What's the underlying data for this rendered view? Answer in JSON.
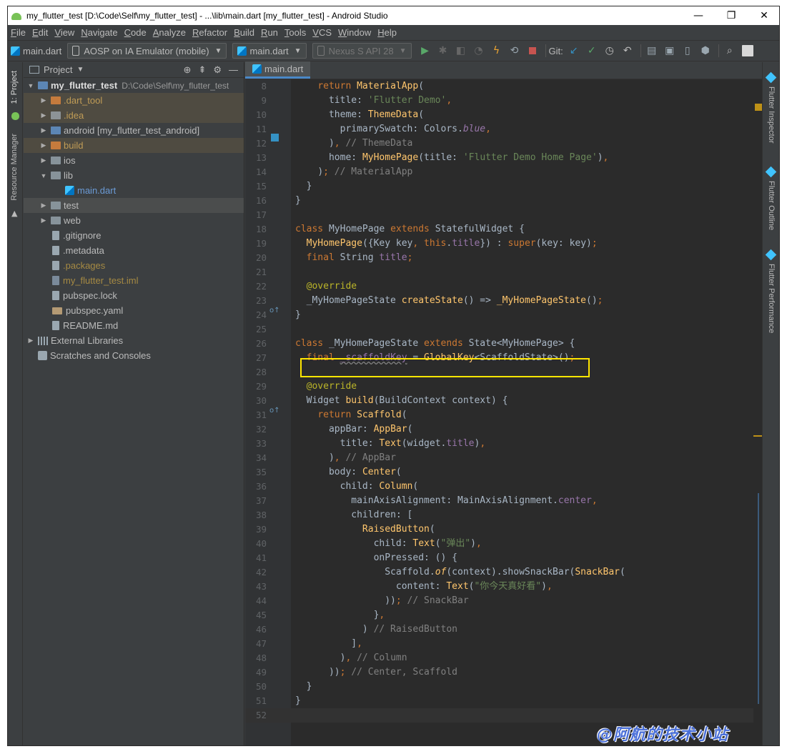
{
  "window": {
    "title": "my_flutter_test [D:\\Code\\Self\\my_flutter_test] - ...\\lib\\main.dart [my_flutter_test] - Android Studio",
    "minimize": "—",
    "maximize": "❐",
    "close": "✕"
  },
  "menu": [
    "File",
    "Edit",
    "View",
    "Navigate",
    "Code",
    "Analyze",
    "Refactor",
    "Build",
    "Run",
    "Tools",
    "VCS",
    "Window",
    "Help"
  ],
  "toolbar": {
    "crumb": "main.dart",
    "device": "AOSP on IA Emulator (mobile)",
    "run_config": "main.dart",
    "avd": "Nexus S API 28",
    "git_label": "Git:"
  },
  "left_strip": {
    "project_tab": "1: Project",
    "resource_tab": "Resource Manager"
  },
  "project_panel": {
    "header": "Project",
    "tree": [
      {
        "label": "my_flutter_test",
        "path": "D:\\Code\\Self\\my_flutter_test",
        "style": "bold",
        "icon": "module-folder-icon",
        "indent": 0,
        "twisty": "▼",
        "highlight": ""
      },
      {
        "label": ".dart_tool",
        "style": "orange",
        "icon": "orange-folder-icon",
        "indent": 1,
        "twisty": "▶",
        "highlight": "hl"
      },
      {
        "label": ".idea",
        "style": "orange",
        "icon": "grey-folder-icon",
        "indent": 1,
        "twisty": "▶",
        "highlight": "hl"
      },
      {
        "label": "android [my_flutter_test_android]",
        "style": "default",
        "icon": "module-folder-icon",
        "indent": 1,
        "twisty": "▶",
        "highlight": ""
      },
      {
        "label": "build",
        "style": "orange",
        "icon": "orange-folder-icon",
        "indent": 1,
        "twisty": "▶",
        "highlight": "hl"
      },
      {
        "label": "ios",
        "style": "default",
        "icon": "folder-icon",
        "indent": 1,
        "twisty": "▶",
        "highlight": ""
      },
      {
        "label": "lib",
        "style": "default",
        "icon": "folder-icon",
        "indent": 1,
        "twisty": "▼",
        "highlight": ""
      },
      {
        "label": "main.dart",
        "style": "blue",
        "icon": "dart-file-icon",
        "indent": 2,
        "twisty": "",
        "highlight": ""
      },
      {
        "label": "test",
        "style": "default",
        "icon": "folder-icon",
        "indent": 1,
        "twisty": "▶",
        "highlight": "sel"
      },
      {
        "label": "web",
        "style": "default",
        "icon": "folder-icon",
        "indent": 1,
        "twisty": "▶",
        "highlight": ""
      },
      {
        "label": ".gitignore",
        "style": "default",
        "icon": "file-icon",
        "indent": 1,
        "twisty": "",
        "highlight": ""
      },
      {
        "label": ".metadata",
        "style": "default",
        "icon": "file-icon",
        "indent": 1,
        "twisty": "",
        "highlight": ""
      },
      {
        "label": ".packages",
        "style": "yellow",
        "icon": "file-icon",
        "indent": 1,
        "twisty": "",
        "highlight": ""
      },
      {
        "label": "my_flutter_test.iml",
        "style": "yellow",
        "icon": "iml-file-icon",
        "indent": 1,
        "twisty": "",
        "highlight": ""
      },
      {
        "label": "pubspec.lock",
        "style": "default",
        "icon": "file-icon",
        "indent": 1,
        "twisty": "",
        "highlight": ""
      },
      {
        "label": "pubspec.yaml",
        "style": "default",
        "icon": "yaml-file-icon",
        "indent": 1,
        "twisty": "",
        "highlight": ""
      },
      {
        "label": "README.md",
        "style": "default",
        "icon": "file-icon",
        "indent": 1,
        "twisty": "",
        "highlight": ""
      },
      {
        "label": "External Libraries",
        "style": "default",
        "icon": "library-icon",
        "indent": 0,
        "twisty": "▶",
        "highlight": ""
      },
      {
        "label": "Scratches and Consoles",
        "style": "default",
        "icon": "scratch-icon",
        "indent": 0,
        "twisty": "",
        "highlight": ""
      }
    ]
  },
  "editor": {
    "tab": "main.dart",
    "lines": [
      {
        "n": "8",
        "html": "    <span class=\"k\">return</span> <span class=\"fn\">MaterialApp</span><span class=\"w\">(</span>"
      },
      {
        "n": "9",
        "html": "      <span class=\"w\">title: </span><span class=\"s\">'Flutter Demo'</span><span class=\"k\">,</span>"
      },
      {
        "n": "10",
        "html": "      <span class=\"w\">theme: </span><span class=\"fn\">ThemeData</span><span class=\"w\">(</span>"
      },
      {
        "n": "11",
        "html": "        <span class=\"w\">primarySwatch: Colors.</span><span class=\"pi\">blue</span><span class=\"k\">,</span>"
      },
      {
        "n": "12",
        "html": "      <span class=\"w\">)</span><span class=\"k\">,</span> <span class=\"c\">// ThemeData</span>"
      },
      {
        "n": "13",
        "html": "      <span class=\"w\">home: </span><span class=\"fn\">MyHomePage</span><span class=\"w\">(title: </span><span class=\"s\">'Flutter Demo Home Page'</span><span class=\"w\">)</span><span class=\"k\">,</span>"
      },
      {
        "n": "14",
        "html": "    <span class=\"w\">)</span><span class=\"k\">;</span> <span class=\"c\">// MaterialApp</span>"
      },
      {
        "n": "15",
        "html": "  <span class=\"w\">}</span>"
      },
      {
        "n": "16",
        "html": "<span class=\"w\">}</span>"
      },
      {
        "n": "17",
        "html": ""
      },
      {
        "n": "18",
        "html": "<span class=\"k\">class</span> <span class=\"w\">MyHomePage </span><span class=\"k\">extends</span> <span class=\"w\">StatefulWidget {</span>"
      },
      {
        "n": "19",
        "html": "  <span class=\"fn\">MyHomePage</span><span class=\"w\">({Key key</span><span class=\"k\">,</span> <span class=\"k\">this</span><span class=\"w\">.</span><span class=\"p\">title</span><span class=\"w\">}) : </span><span class=\"k\">super</span><span class=\"w\">(key: key)</span><span class=\"k\">;</span>"
      },
      {
        "n": "20",
        "html": "  <span class=\"k\">final</span> <span class=\"w\">String </span><span class=\"p\">title</span><span class=\"k\">;</span>"
      },
      {
        "n": "21",
        "html": ""
      },
      {
        "n": "22",
        "html": "  <span class=\"a\">@override</span>"
      },
      {
        "n": "23",
        "html": "  <span class=\"w\">_MyHomePageState </span><span class=\"fn\">createState</span><span class=\"w\">() =&gt; </span><span class=\"fn\">_MyHomePageState</span><span class=\"w\">()</span><span class=\"k\">;</span>"
      },
      {
        "n": "24",
        "html": "<span class=\"w\">}</span>"
      },
      {
        "n": "25",
        "html": ""
      },
      {
        "n": "26",
        "html": "<span class=\"k\">class</span> <span class=\"w\">_MyHomePageState </span><span class=\"k\">extends</span> <span class=\"w\">State&lt;MyHomePage&gt; {</span>"
      },
      {
        "n": "27",
        "html": "  <span class=\"k\">final</span> <span class=\"p\" style=\"text-decoration: underline wavy #808080;\">_scaffoldKey</span> <span class=\"w\">= </span><span class=\"fn\">GlobalKey</span><span class=\"w\">&lt;ScaffoldState&gt;()</span><span class=\"k\">;</span>"
      },
      {
        "n": "28",
        "html": ""
      },
      {
        "n": "29",
        "html": "  <span class=\"a\">@override</span>"
      },
      {
        "n": "30",
        "html": "  <span class=\"w\">Widget </span><span class=\"fn\">build</span><span class=\"w\">(BuildContext context) {</span>"
      },
      {
        "n": "31",
        "html": "    <span class=\"k\">return</span> <span class=\"fn\">Scaffold</span><span class=\"w\">(</span>"
      },
      {
        "n": "32",
        "html": "      <span class=\"w\">appBar: </span><span class=\"fn\">AppBar</span><span class=\"w\">(</span>"
      },
      {
        "n": "33",
        "html": "        <span class=\"w\">title: </span><span class=\"fn\">Text</span><span class=\"w\">(widget.</span><span class=\"p\">title</span><span class=\"w\">)</span><span class=\"k\">,</span>"
      },
      {
        "n": "34",
        "html": "      <span class=\"w\">)</span><span class=\"k\">,</span> <span class=\"c\">// AppBar</span>"
      },
      {
        "n": "35",
        "html": "      <span class=\"w\">body: </span><span class=\"fn\">Center</span><span class=\"w\">(</span>"
      },
      {
        "n": "36",
        "html": "        <span class=\"w\">child: </span><span class=\"fn\">Column</span><span class=\"w\">(</span>"
      },
      {
        "n": "37",
        "html": "          <span class=\"w\">mainAxisAlignment: MainAxisAlignment.</span><span class=\"p\">center</span><span class=\"k\">,</span>"
      },
      {
        "n": "38",
        "html": "          <span class=\"w\">children: [</span>"
      },
      {
        "n": "39",
        "html": "            <span class=\"fn\">RaisedButton</span><span class=\"w\">(</span>"
      },
      {
        "n": "40",
        "html": "              <span class=\"w\">child: </span><span class=\"fn\">Text</span><span class=\"w\">(</span><span class=\"s\">\"弹出\"</span><span class=\"w\">)</span><span class=\"k\">,</span>"
      },
      {
        "n": "41",
        "html": "              <span class=\"w\">onPressed: () {</span>"
      },
      {
        "n": "42",
        "html": "                <span class=\"w\">Scaffold.</span><span class=\"fn\" style=\"font-style:italic\">of</span><span class=\"w\">(context).showSnackBar(</span><span class=\"fn\">SnackBar</span><span class=\"w\">(</span>"
      },
      {
        "n": "43",
        "html": "                  <span class=\"w\">content: </span><span class=\"fn\">Text</span><span class=\"w\">(</span><span class=\"s\">\"你今天真好看\"</span><span class=\"w\">)</span><span class=\"k\">,</span>"
      },
      {
        "n": "44",
        "html": "                <span class=\"w\">))</span><span class=\"k\">;</span> <span class=\"c\">// SnackBar</span>"
      },
      {
        "n": "45",
        "html": "              <span class=\"w\">}</span><span class=\"k\">,</span>"
      },
      {
        "n": "46",
        "html": "            <span class=\"w\">) </span><span class=\"c\">// RaisedButton</span>"
      },
      {
        "n": "47",
        "html": "          <span class=\"w\">]</span><span class=\"k\">,</span>"
      },
      {
        "n": "48",
        "html": "        <span class=\"w\">)</span><span class=\"k\">,</span> <span class=\"c\">// Column</span>"
      },
      {
        "n": "49",
        "html": "      <span class=\"w\">))</span><span class=\"k\">;</span> <span class=\"c\">// Center, Scaffold</span>"
      },
      {
        "n": "50",
        "html": "  <span class=\"w\">}</span>"
      },
      {
        "n": "51",
        "html": "<span class=\"w\">}</span>"
      },
      {
        "n": "52",
        "html": ""
      }
    ]
  },
  "right_strip": {
    "tabs": [
      "Flutter Inspector",
      "Flutter Outline",
      "Flutter Performance"
    ]
  },
  "watermark": "@阿航的技术小站"
}
